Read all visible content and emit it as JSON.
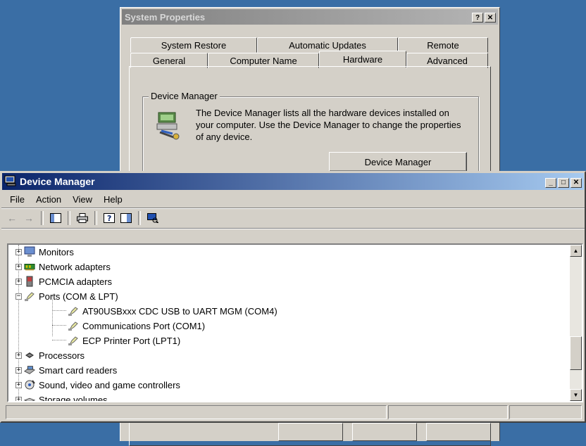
{
  "system_properties": {
    "title": "System Properties",
    "help_btn": "?",
    "close_btn": "✕",
    "tabs_back": [
      "System Restore",
      "Automatic Updates",
      "Remote"
    ],
    "tabs_front": [
      "General",
      "Computer Name",
      "Hardware",
      "Advanced"
    ],
    "active_tab": "Hardware",
    "device_manager_group": {
      "legend": "Device Manager",
      "description": "The Device Manager lists all the hardware devices installed on your computer. Use the Device Manager to change the properties of any device.",
      "button": "Device Manager"
    }
  },
  "device_manager": {
    "title": "Device Manager",
    "controls": {
      "minimize": "_",
      "maximize": "□",
      "close": "✕"
    },
    "menu": [
      "File",
      "Action",
      "View",
      "Help"
    ],
    "tree": [
      {
        "label": "Monitors",
        "expander": "+",
        "icon": "monitor-icon"
      },
      {
        "label": "Network adapters",
        "expander": "+",
        "icon": "network-adapter-icon"
      },
      {
        "label": "PCMCIA adapters",
        "expander": "+",
        "icon": "pcmcia-icon"
      },
      {
        "label": "Ports (COM & LPT)",
        "expander": "−",
        "icon": "port-icon"
      },
      {
        "label": "AT90USBxxx CDC USB to UART MGM (COM4)",
        "icon": "port-icon"
      },
      {
        "label": "Communications Port (COM1)",
        "icon": "port-icon"
      },
      {
        "label": "ECP Printer Port (LPT1)",
        "icon": "port-icon"
      },
      {
        "label": "Processors",
        "expander": "+",
        "icon": "processor-icon"
      },
      {
        "label": "Smart card readers",
        "expander": "+",
        "icon": "smart-card-icon"
      },
      {
        "label": "Sound, video and game controllers",
        "expander": "+",
        "icon": "sound-icon"
      },
      {
        "label": "Storage volumes",
        "expander": "+",
        "icon": "storage-icon"
      }
    ]
  },
  "colors": {
    "desktop": "#3a6ea5",
    "active_title_start": "#0a246a",
    "active_title_end": "#a6caf0",
    "face": "#d4d0c8"
  }
}
